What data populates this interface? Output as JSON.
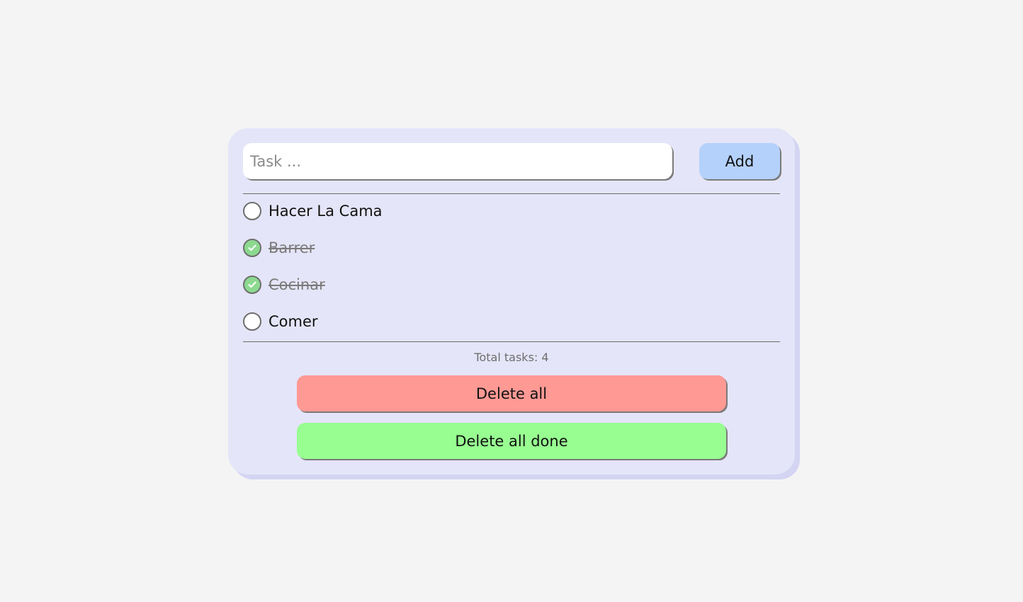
{
  "input": {
    "placeholder": "Task ...",
    "value": ""
  },
  "add_label": "Add",
  "tasks": [
    {
      "label": "Hacer La Cama",
      "done": false
    },
    {
      "label": "Barrer",
      "done": true
    },
    {
      "label": "Cocinar",
      "done": true
    },
    {
      "label": "Comer",
      "done": false
    }
  ],
  "total_text": "Total tasks: 4",
  "delete_all_label": "Delete all",
  "delete_done_label": "Delete all done",
  "colors": {
    "page_bg": "#f4f4f4",
    "card_bg": "#e5e5f9",
    "add_button": "#b4d1fb",
    "delete_all": "#fe9994",
    "delete_done": "#98fe91",
    "check_done": "#8cd98f"
  },
  "icons": {
    "done_check": "checkmark-icon"
  }
}
